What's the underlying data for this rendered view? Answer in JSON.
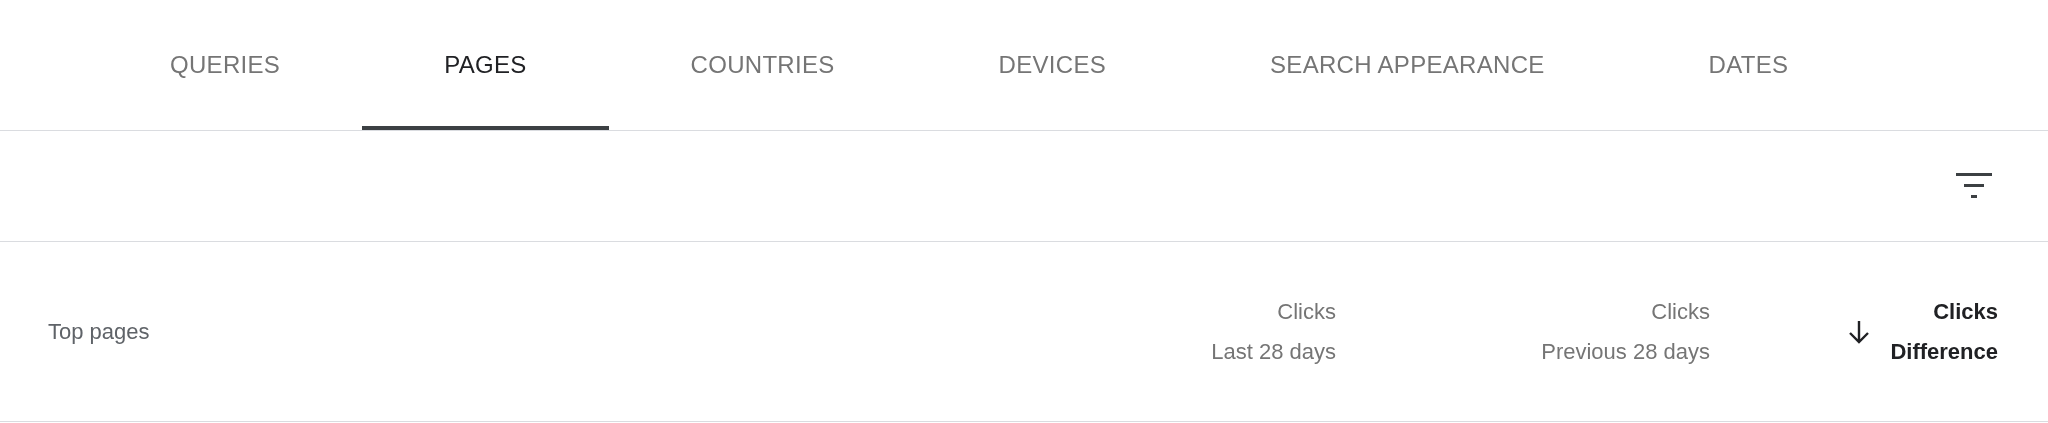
{
  "tabs": [
    {
      "label": "QUERIES",
      "selected": false
    },
    {
      "label": "PAGES",
      "selected": true
    },
    {
      "label": "COUNTRIES",
      "selected": false
    },
    {
      "label": "DEVICES",
      "selected": false
    },
    {
      "label": "SEARCH APPEARANCE",
      "selected": false
    },
    {
      "label": "DATES",
      "selected": false
    }
  ],
  "table": {
    "columns": [
      {
        "kind": "label",
        "lines": [
          "Top pages"
        ]
      },
      {
        "kind": "metric",
        "lines": [
          "Clicks",
          "Last 28 days"
        ],
        "sorted": false
      },
      {
        "kind": "metric",
        "lines": [
          "Clicks",
          "Previous 28 days"
        ],
        "sorted": false
      },
      {
        "kind": "metric",
        "lines": [
          "Clicks",
          "Difference"
        ],
        "sorted": true
      }
    ]
  }
}
